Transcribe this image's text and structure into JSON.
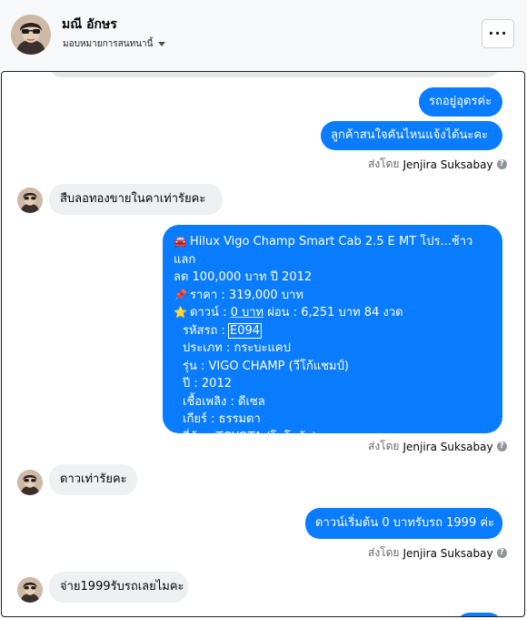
{
  "header": {
    "name": "มณี อักษร",
    "subtitle": "มอบหมายการสนทนานี้",
    "more_label": "···"
  },
  "messages": [
    {
      "text": "รถอยู่อุดรค่ะ"
    },
    {
      "text": "ลูกค้าสนใจคันไหนแจ้งได้นะคะ"
    },
    {
      "text": "สืบลอทองขายในคาเท่ารัยคะ"
    },
    {
      "text": "ดาวเท่ารัยคะ"
    },
    {
      "text": "ดาวน์เริ่มต้น 0 บาทรับรถ 1999 ค่ะ"
    },
    {
      "text": "จ่าย1999รับรถเลยไมคะ"
    }
  ],
  "sent_by": {
    "prefix": "ส่งโดย",
    "name": "Jenjira Suksabay",
    "help_icon": "?"
  },
  "listing": {
    "title_line1": "Hilux Vigo Champ Smart Cab 2.5 E MT โปร...ช้าว แลก",
    "title_line2": "ลด 100,000 บาท ปี 2012",
    "price": "ราคา : 319,000 บาท",
    "down_prefix": "ดาวน์ : ",
    "down_value": "0 บาท",
    "down_suffix": " ผ่อน : 6,251 บาท 84 งวด",
    "code_prefix": "รหัสรถ : ",
    "code_value": "E094",
    "type": "ประเภท : กระบะแคป",
    "model": "รุ่น : VIGO CHAMP (วีโก้แชมป์)",
    "year": "ปี : 2012",
    "fuel": "เชื้อเพลิง : ดีเซล",
    "gear": "เกียร์ : ธรรมดา",
    "brand": "ยี่ห้อ : TOYOTA (โตโยต้า)",
    "icons": {
      "car": "🚘",
      "pin": "📌",
      "star": "⭐"
    }
  },
  "colors": {
    "outgoing_bubble": "#0a7cff",
    "incoming_bubble": "#eff0f2",
    "header_bg": "#f7f8fa"
  }
}
